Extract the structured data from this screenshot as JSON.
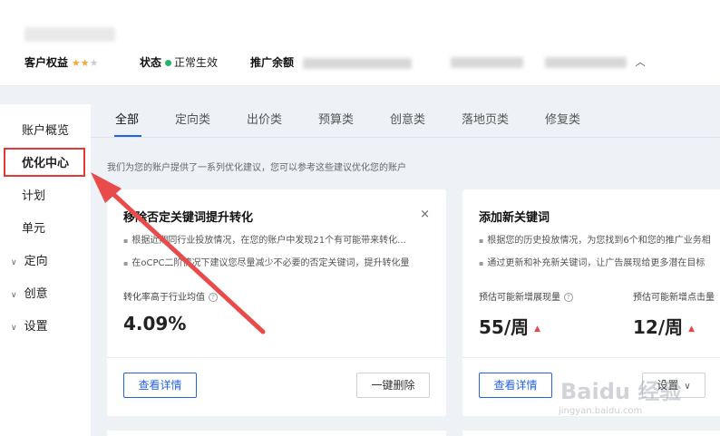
{
  "header": {
    "customer_rights_label": "客户权益",
    "status_label": "状态",
    "status_value": "正常生效",
    "promotion_label": "推广余额"
  },
  "sidebar": {
    "items": [
      {
        "label": "账户概览"
      },
      {
        "label": "优化中心"
      },
      {
        "label": "计划"
      },
      {
        "label": "单元"
      },
      {
        "label": "定向"
      },
      {
        "label": "创意"
      },
      {
        "label": "设置"
      }
    ]
  },
  "tabs": [
    {
      "label": "全部"
    },
    {
      "label": "定向类"
    },
    {
      "label": "出价类"
    },
    {
      "label": "预算类"
    },
    {
      "label": "创意类"
    },
    {
      "label": "落地页类"
    },
    {
      "label": "修复类"
    }
  ],
  "intro_text": "我们为您的账户提供了一系列优化建议，您可以参考这些建议优化您的账户",
  "cards": [
    {
      "title": "移除否定关键词提升转化",
      "close": "×",
      "bullets": [
        "根据近期同行业投放情况，在您的账户中发现21个有可能带来转化...",
        "在oCPC二阶情况下建议您尽量减少不必要的否定关键词，提升转化量"
      ],
      "metric_label": "转化率高于行业均值",
      "metric_value": "4.09%",
      "primary_button": "查看详情",
      "secondary_button": "一键删除"
    },
    {
      "title": "添加新关键词",
      "bullets": [
        "根据您的历史投放情况，为您找到6个和您的推广业务相",
        "通过更新和补充新关键词，让广告展现给更多潜在目标"
      ],
      "metric1_label": "预估可能新增展现量",
      "metric1_value": "55/周",
      "metric2_label": "预估可能新增点击量",
      "metric2_value": "12/周",
      "primary_button": "查看详情",
      "secondary_button": "设置"
    }
  ],
  "watermark": {
    "brand": "Baidu 经验",
    "url": "jingyan.baidu.com"
  },
  "colors": {
    "accent": "#2463e8",
    "highlight": "#e53935",
    "arrow": "#e94b4b",
    "status_dot": "#27b36b",
    "star": "#f3a83b",
    "trend_up": "#e54848"
  }
}
